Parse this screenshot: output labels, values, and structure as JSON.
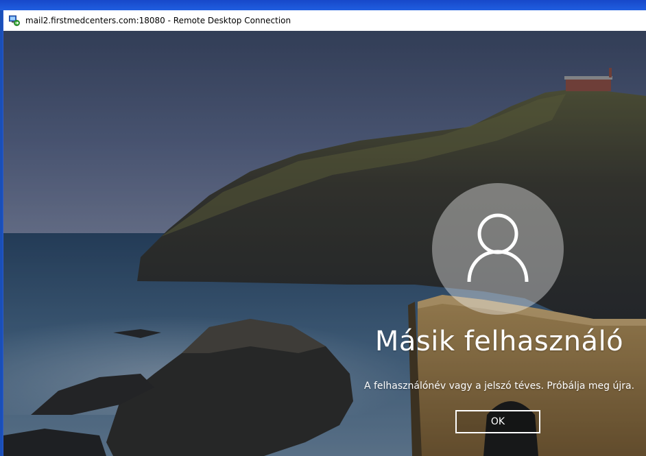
{
  "window": {
    "title": "mail2.firstmedcenters.com:18080 - Remote Desktop Connection",
    "icon": "remote-desktop-icon"
  },
  "lock_screen": {
    "avatar_icon": "user-silhouette-icon",
    "username": "Másik felhasználó",
    "error_message": "A felhasználónév vagy a jelszó téves. Próbálja meg újra.",
    "ok_label": "OK"
  },
  "colors": {
    "desktop_blue": "#1f5ee0",
    "text": "#ffffff",
    "sky": "#6b7b9a",
    "sea": "#3c5f80"
  }
}
